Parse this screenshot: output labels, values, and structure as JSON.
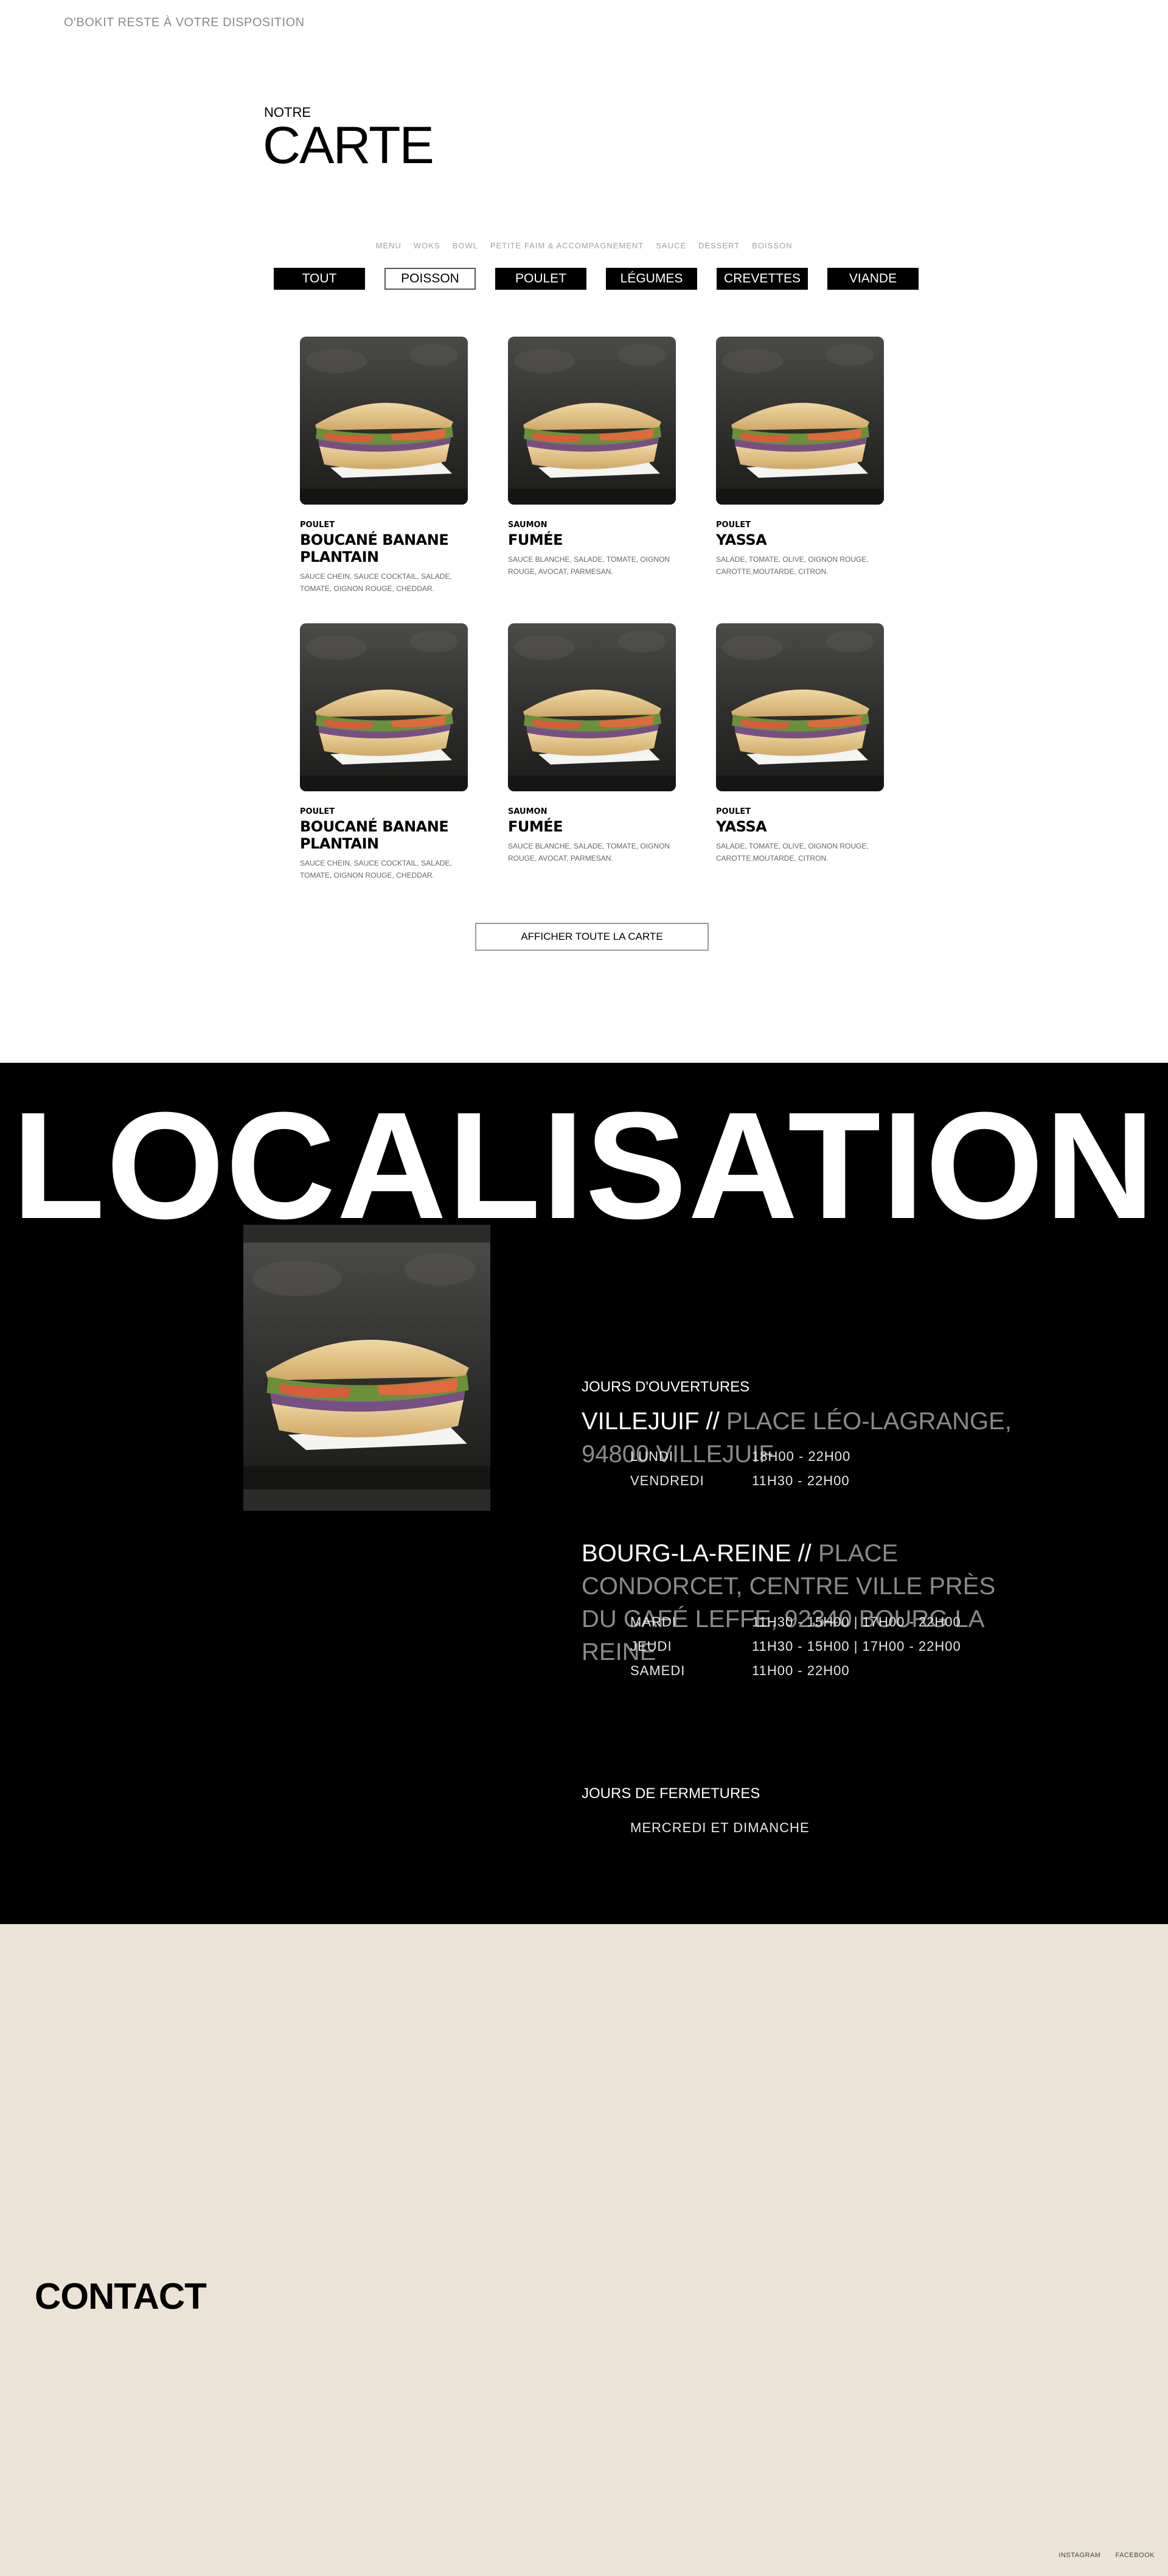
{
  "header": {
    "tagline": "O'BOKIT RESTE À VOTRE DISPOSITION",
    "carte_small": "NOTRE",
    "carte_big": "CARTE"
  },
  "category_links": [
    "MENU",
    "WOKS",
    "BOWL",
    "PETITE FAIM & ACCOMPAGNEMENT",
    "SAUCE",
    "DESSERT",
    "BOISSON"
  ],
  "filters": [
    {
      "label": "TOUT",
      "active": false
    },
    {
      "label": "POISSON",
      "active": true
    },
    {
      "label": "POULET",
      "active": false
    },
    {
      "label": "LÉGUMES",
      "active": false
    },
    {
      "label": "CREVETTES",
      "active": false
    },
    {
      "label": "VIANDE",
      "active": false
    }
  ],
  "cards": [
    {
      "category": "POULET",
      "name": "BOUCANÉ BANANE PLANTAIN",
      "desc": "SAUCE CHEIN, SAUCE COCKTAIL, SALADE, TOMATE, OIGNON ROUGE, CHEDDAR."
    },
    {
      "category": "SAUMON",
      "name": "FUMÉE",
      "desc": "SAUCE BLANCHE, SALADE, TOMATE, OIGNON ROUGE, AVOCAT, PARMESAN."
    },
    {
      "category": "POULET",
      "name": "YASSA",
      "desc": "SALADE, TOMATE, OLIVE, OIGNON ROUGE, CAROTTE,MOUTARDE, CITRON."
    },
    {
      "category": "POULET",
      "name": "BOUCANÉ BANANE PLANTAIN",
      "desc": "SAUCE CHEIN, SAUCE COCKTAIL, SALADE, TOMATE, OIGNON ROUGE, CHEDDAR."
    },
    {
      "category": "SAUMON",
      "name": "FUMÉE",
      "desc": "SAUCE BLANCHE, SALADE, TOMATE, OIGNON ROUGE, AVOCAT, PARMESAN."
    },
    {
      "category": "POULET",
      "name": "YASSA",
      "desc": "SALADE, TOMATE, OLIVE, OIGNON ROUGE, CAROTTE,MOUTARDE, CITRON."
    }
  ],
  "show_all_label": "AFFICHER TOUTE LA CARTE",
  "localisation": {
    "title": "LOCALISATION",
    "opening_heading": "JOURS D'OUVERTURES",
    "villejuif": {
      "city": "VILLEJUIF //",
      "address": "PLACE LÉO-LAGRANGE, 94800 VILLEJUIF",
      "hours": [
        {
          "day": "LUNDI",
          "time": "18H00 - 22H00"
        },
        {
          "day": "VENDREDI",
          "time": "11H30 - 22H00"
        }
      ]
    },
    "bourg": {
      "city": "BOURG-LA-REINE //",
      "address": "PLACE CONDORCET, CENTRE VILLE PRÈS DU CAFÉ LEFFE, 92340 BOURG LA REINE",
      "hours": [
        {
          "day": "MARDI",
          "time": "11H30 - 15H00  |  17H00 - 22H00"
        },
        {
          "day": "JEUDI",
          "time": "11H30 - 15H00  |  17H00 - 22H00"
        },
        {
          "day": "SAMEDI",
          "time": "11H00 - 22H00"
        }
      ]
    },
    "closing_heading": "JOURS DE FERMETURES",
    "closing_days": "MERCREDI ET DIMANCHE"
  },
  "contact_title": "CONTACT",
  "footer_links": [
    "INSTAGRAM",
    "FACEBOOK"
  ]
}
